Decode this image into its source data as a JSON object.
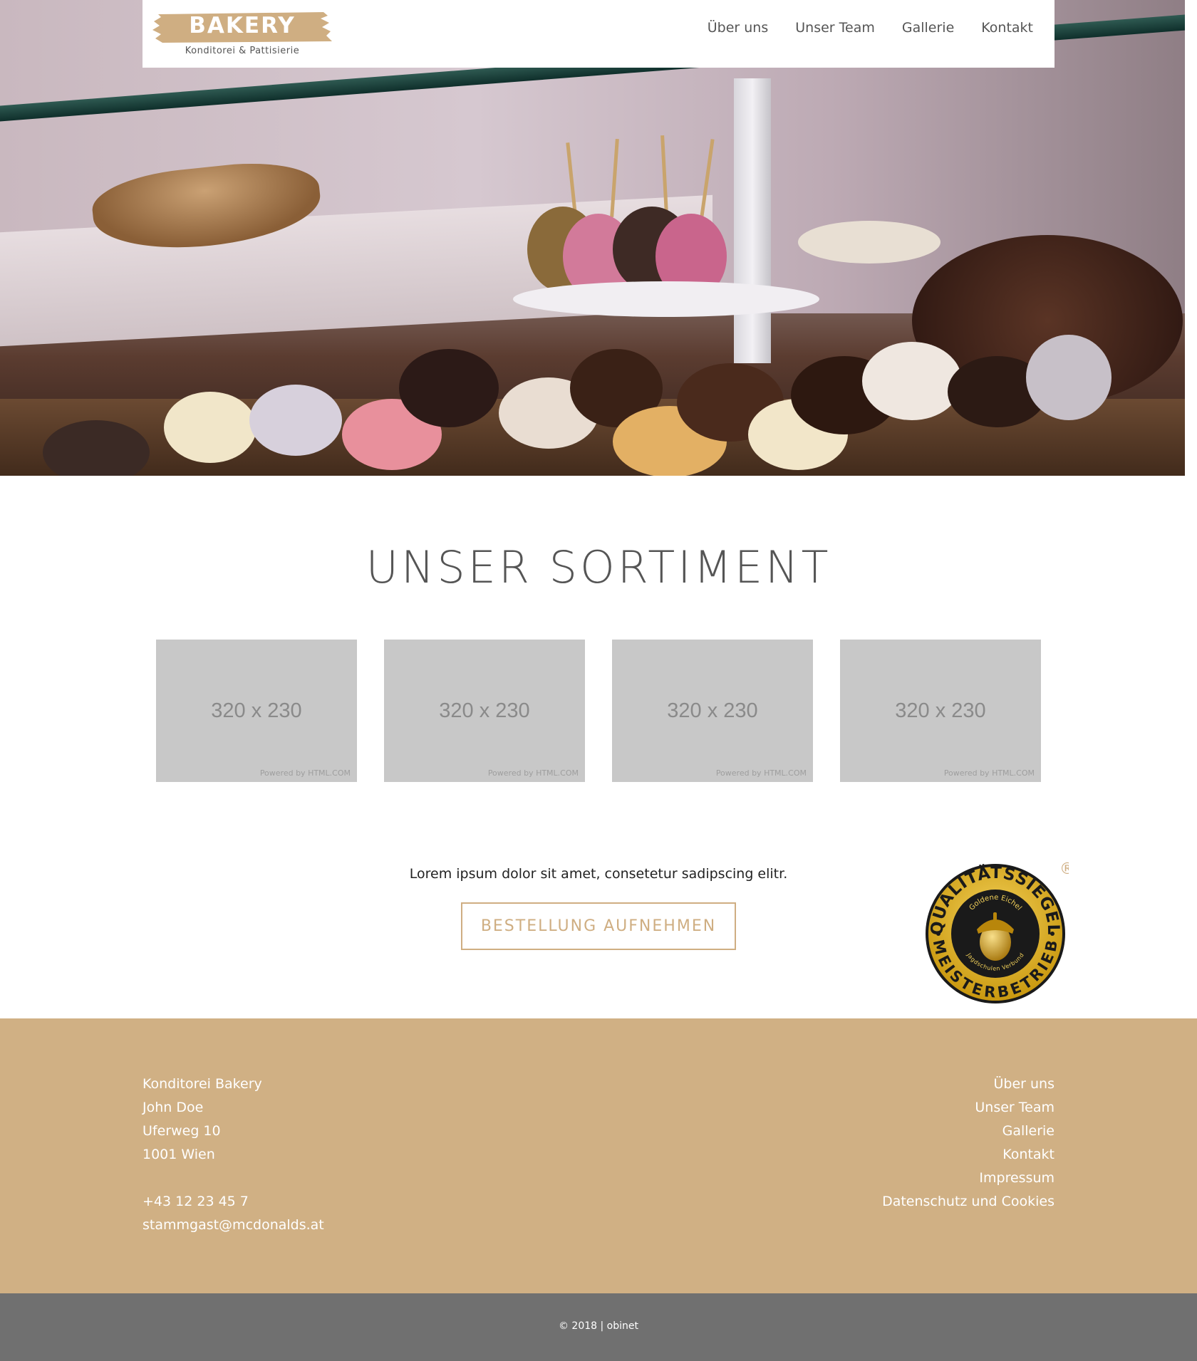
{
  "header": {
    "logo_text": "BAKERY",
    "logo_tagline": "Konditorei & Pattisierie",
    "nav": [
      "Über uns",
      "Unser Team",
      "Gallerie",
      "Kontakt"
    ]
  },
  "sortiment": {
    "title": "UNSER SORTIMENT",
    "products": [
      {
        "placeholder": "320 x 230",
        "powered": "Powered by HTML.COM"
      },
      {
        "placeholder": "320 x 230",
        "powered": "Powered by HTML.COM"
      },
      {
        "placeholder": "320 x 230",
        "powered": "Powered by HTML.COM"
      },
      {
        "placeholder": "320 x 230",
        "powered": "Powered by HTML.COM"
      }
    ]
  },
  "cta": {
    "text": "Lorem ipsum dolor sit amet, consetetur sadipscing elitr.",
    "button": "BESTELLUNG AUFNEHMEN"
  },
  "seal": {
    "top_text": "QUALITÄTSSIEGEL",
    "bottom_text": "MEISTERBETRIEB",
    "inner_top": "Goldene Eichel",
    "inner_bottom": "Jagdschulen Verbund",
    "registered": "®"
  },
  "footer": {
    "address": [
      "Konditorei Bakery",
      "John Doe",
      "Uferweg 10",
      "1001 Wien",
      "",
      "+43 12 23 45 7",
      "stammgast@mcdonalds.at"
    ],
    "links": [
      "Über uns",
      "Unser Team",
      "Gallerie",
      "Kontakt",
      "Impressum",
      "Datenschutz und Cookies"
    ],
    "copyright": "© 2018 | obinet"
  },
  "colors": {
    "accent": "#cfae82",
    "footer_bg": "#d0b084",
    "bottom_bg": "#707070"
  }
}
